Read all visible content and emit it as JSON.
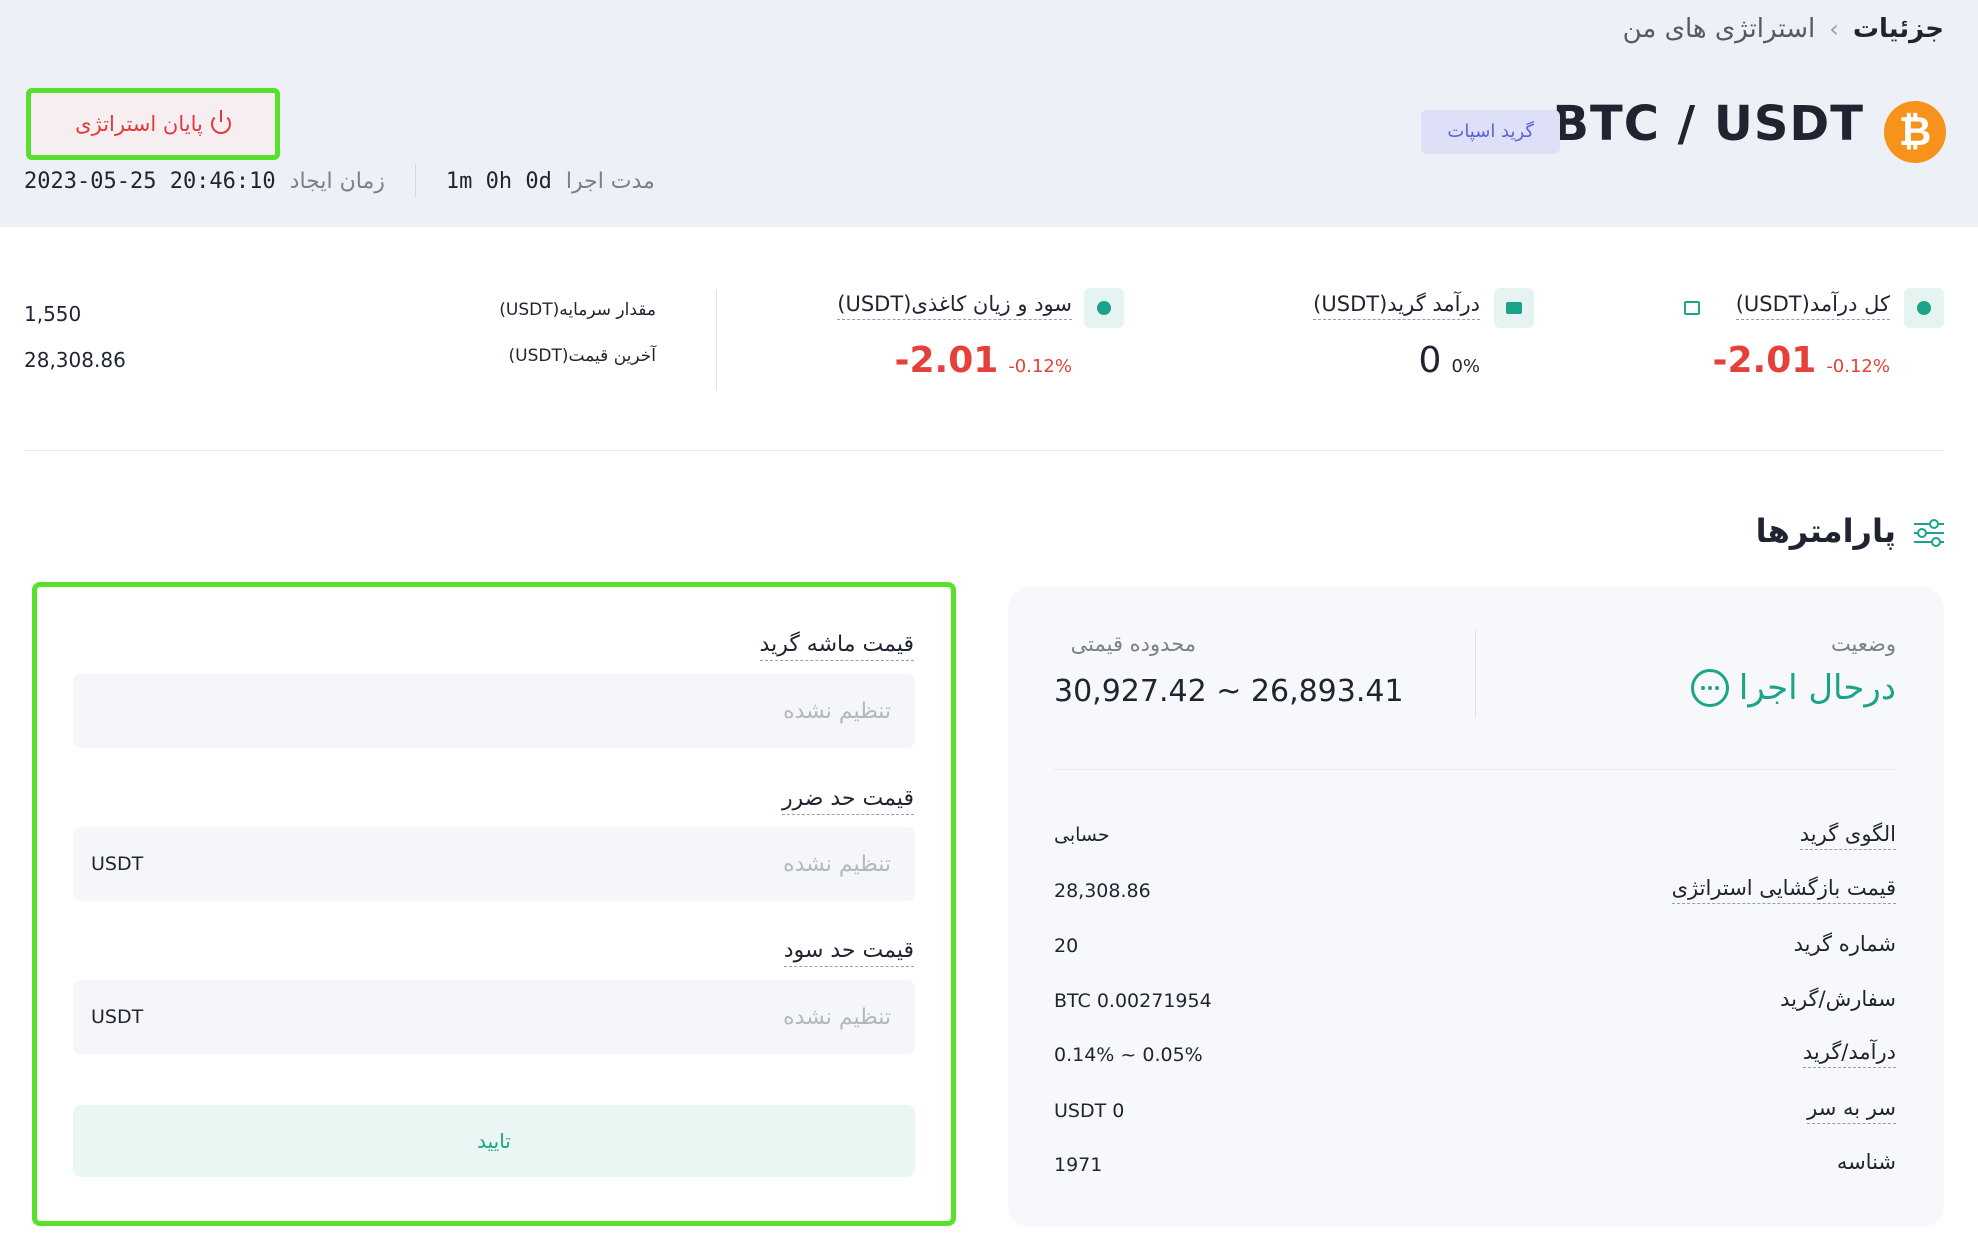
{
  "breadcrumb": {
    "parent": "استراتژی های من",
    "separator": "›",
    "current": "جزئیات"
  },
  "header": {
    "coin_symbol": "₿",
    "pair": "BTC / USDT",
    "badge": "گرید اسپات",
    "end_button": "پایان استراتژی",
    "run_label": "مدت اجرا",
    "run_value": "1m 0h 0d",
    "created_label": "زمان ایجاد",
    "created_value": "2023-05-25  20:46:10"
  },
  "stats": {
    "total": {
      "label": "کل درآمد(USDT)",
      "value": "-2.01",
      "pct": "-0.12%"
    },
    "grid": {
      "label": "درآمد گرید(USDT)",
      "value": "0",
      "pct": "0%"
    },
    "paper": {
      "label": "سود و زیان کاغذی(USDT)",
      "value": "-2.01",
      "pct": "-0.12%"
    },
    "capital_label": "مقدار سرمایه(USDT)",
    "capital_value": "1,550",
    "last_price_label": "آخرین قیمت(USDT)",
    "last_price_value": "28,308.86"
  },
  "section_title": "پارامترها",
  "form": {
    "trigger_label": "قیمت ماشه گرید",
    "trigger_placeholder": "تنظیم نشده",
    "stop_label": "قیمت حد ضرر",
    "stop_placeholder": "تنظیم نشده",
    "stop_unit": "USDT",
    "take_label": "قیمت حد سود",
    "take_placeholder": "تنظیم نشده",
    "take_unit": "USDT",
    "confirm": "تایید"
  },
  "params": {
    "status_label": "وضعیت",
    "status_value": "درحال اجرا",
    "range_label": "محدوده قیمتی",
    "range_value": "30,927.42 ~ 26,893.41",
    "rows": [
      {
        "label": "الگوی گرید",
        "value": "حسابی"
      },
      {
        "label": "قیمت بازگشایی استراتژی",
        "value": "28,308.86"
      },
      {
        "label": "شماره گرید",
        "value": "20"
      },
      {
        "label": "سفارش/گرید",
        "value": "BTC  0.00271954"
      },
      {
        "label": "درآمد/گرید",
        "value": "0.14% ~ 0.05%"
      },
      {
        "label": "سر به سر",
        "value": "USDT  0"
      },
      {
        "label": "شناسه",
        "value": "1971"
      }
    ]
  },
  "colors": {
    "accent": "#1ba48a",
    "negative": "#e5413a",
    "bitcoin": "#f7931a",
    "highlight": "#58e02a"
  }
}
